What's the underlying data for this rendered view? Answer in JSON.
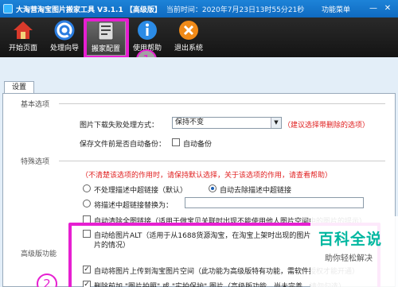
{
  "titlebar": {
    "title": "大淘营淘宝图片搬家工具 V3.1.1 【高级版】",
    "time": "当前时间：2020年7月23日13时55分21秒",
    "menu": "功能菜单",
    "minimize": "—",
    "close": "✕"
  },
  "toolbar": {
    "items": [
      {
        "label": "开始页面",
        "icon": "home-icon"
      },
      {
        "label": "处理向导",
        "icon": "wizard-icon"
      },
      {
        "label": "搬家配置",
        "icon": "config-icon"
      },
      {
        "label": "使用帮助",
        "icon": "help-icon"
      },
      {
        "label": "退出系统",
        "icon": "exit-icon"
      }
    ]
  },
  "annotations": {
    "step1": "1",
    "step2": "2",
    "color": "#e61fd1"
  },
  "tabs": [
    "设置"
  ],
  "basic": {
    "title": "基本选项",
    "download_fail_label": "图片下载失败处理方式：",
    "download_fail_value": "保持不变",
    "download_fail_hint": "（建议选择带删除的选项）",
    "auto_backup_label": "保存文件前是否自动备份：",
    "auto_backup_option": "自动备份"
  },
  "special": {
    "title": "特殊选项",
    "warning": "（不清楚该选项的作用时，请保持默认选择，关于该选项的作用，请查看帮助）",
    "radio_keep": "不处理描述中超链接（默认）",
    "radio_remove": "自动去除描述中超链接",
    "radio_replace": "将描述中超链接替换为：",
    "chk_clear_images": "自动清除全图链接（适用于做宝贝关联时出现不能使用他人图片空间中的图片的提示）",
    "chk_alt_line1": "自动给图片ALT（适用于从1688货源淘宝，在淘宝上架时出现的图片",
    "chk_alt_line2": "片的情况）"
  },
  "advanced": {
    "title": "高级版功能",
    "chk_upload": "自动将图片上传到淘宝图片空间（此功能为高级版特有功能，需软件授权才能开通）",
    "chk_add": "删除前加 \"图片拍照\" 或 \"实拍保护\" 图片（高级版功能，尚未完善，请勿勾选）"
  },
  "watermark": {
    "main": "百科全说",
    "sub": "助你轻松解决"
  }
}
